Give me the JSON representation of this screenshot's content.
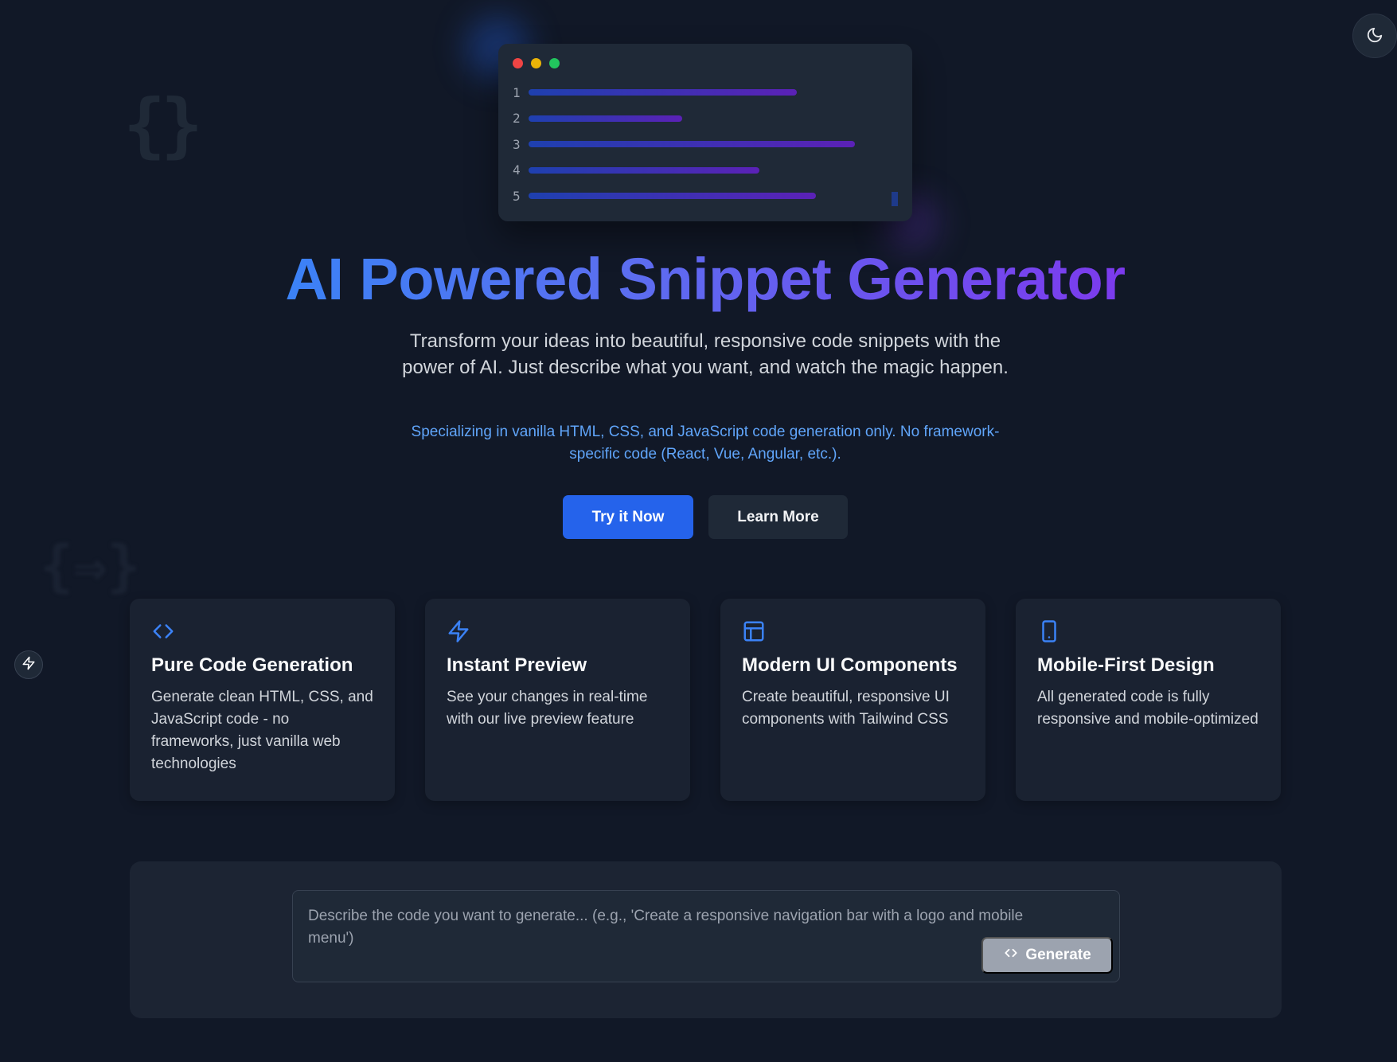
{
  "decorations": {
    "braces": "{}",
    "arrow_glyph": "{⇒}"
  },
  "code_window": {
    "line_numbers": [
      "1",
      "2",
      "3",
      "4",
      "5"
    ]
  },
  "hero": {
    "title": "AI Powered Snippet Generator",
    "subtitle": "Transform your ideas into beautiful, responsive code snippets with the power of AI. Just describe what you want, and watch the magic happen.",
    "note": "Specializing in vanilla HTML, CSS, and JavaScript code generation only. No framework-specific code (React, Vue, Angular, etc.).",
    "primary_button": "Try it Now",
    "secondary_button": "Learn More"
  },
  "features": [
    {
      "icon": "code-icon",
      "title": "Pure Code Generation",
      "text": "Generate clean HTML, CSS, and JavaScript code - no frameworks, just vanilla web technologies"
    },
    {
      "icon": "lightning-icon",
      "title": "Instant Preview",
      "text": "See your changes in real-time with our live preview feature"
    },
    {
      "icon": "layout-icon",
      "title": "Modern UI Components",
      "text": "Create beautiful, responsive UI components with Tailwind CSS"
    },
    {
      "icon": "mobile-icon",
      "title": "Mobile-First Design",
      "text": "All generated code is fully responsive and mobile-optimized"
    }
  ],
  "prompt": {
    "placeholder": "Describe the code you want to generate... (e.g., 'Create a responsive navigation bar with a logo and mobile menu')",
    "generate_button": "Generate"
  },
  "colors": {
    "background": "#111827",
    "accent_blue": "#2563eb",
    "accent_purple": "#7c3aed",
    "note_blue": "#60a5fa",
    "icon_blue": "#3b82f6"
  }
}
